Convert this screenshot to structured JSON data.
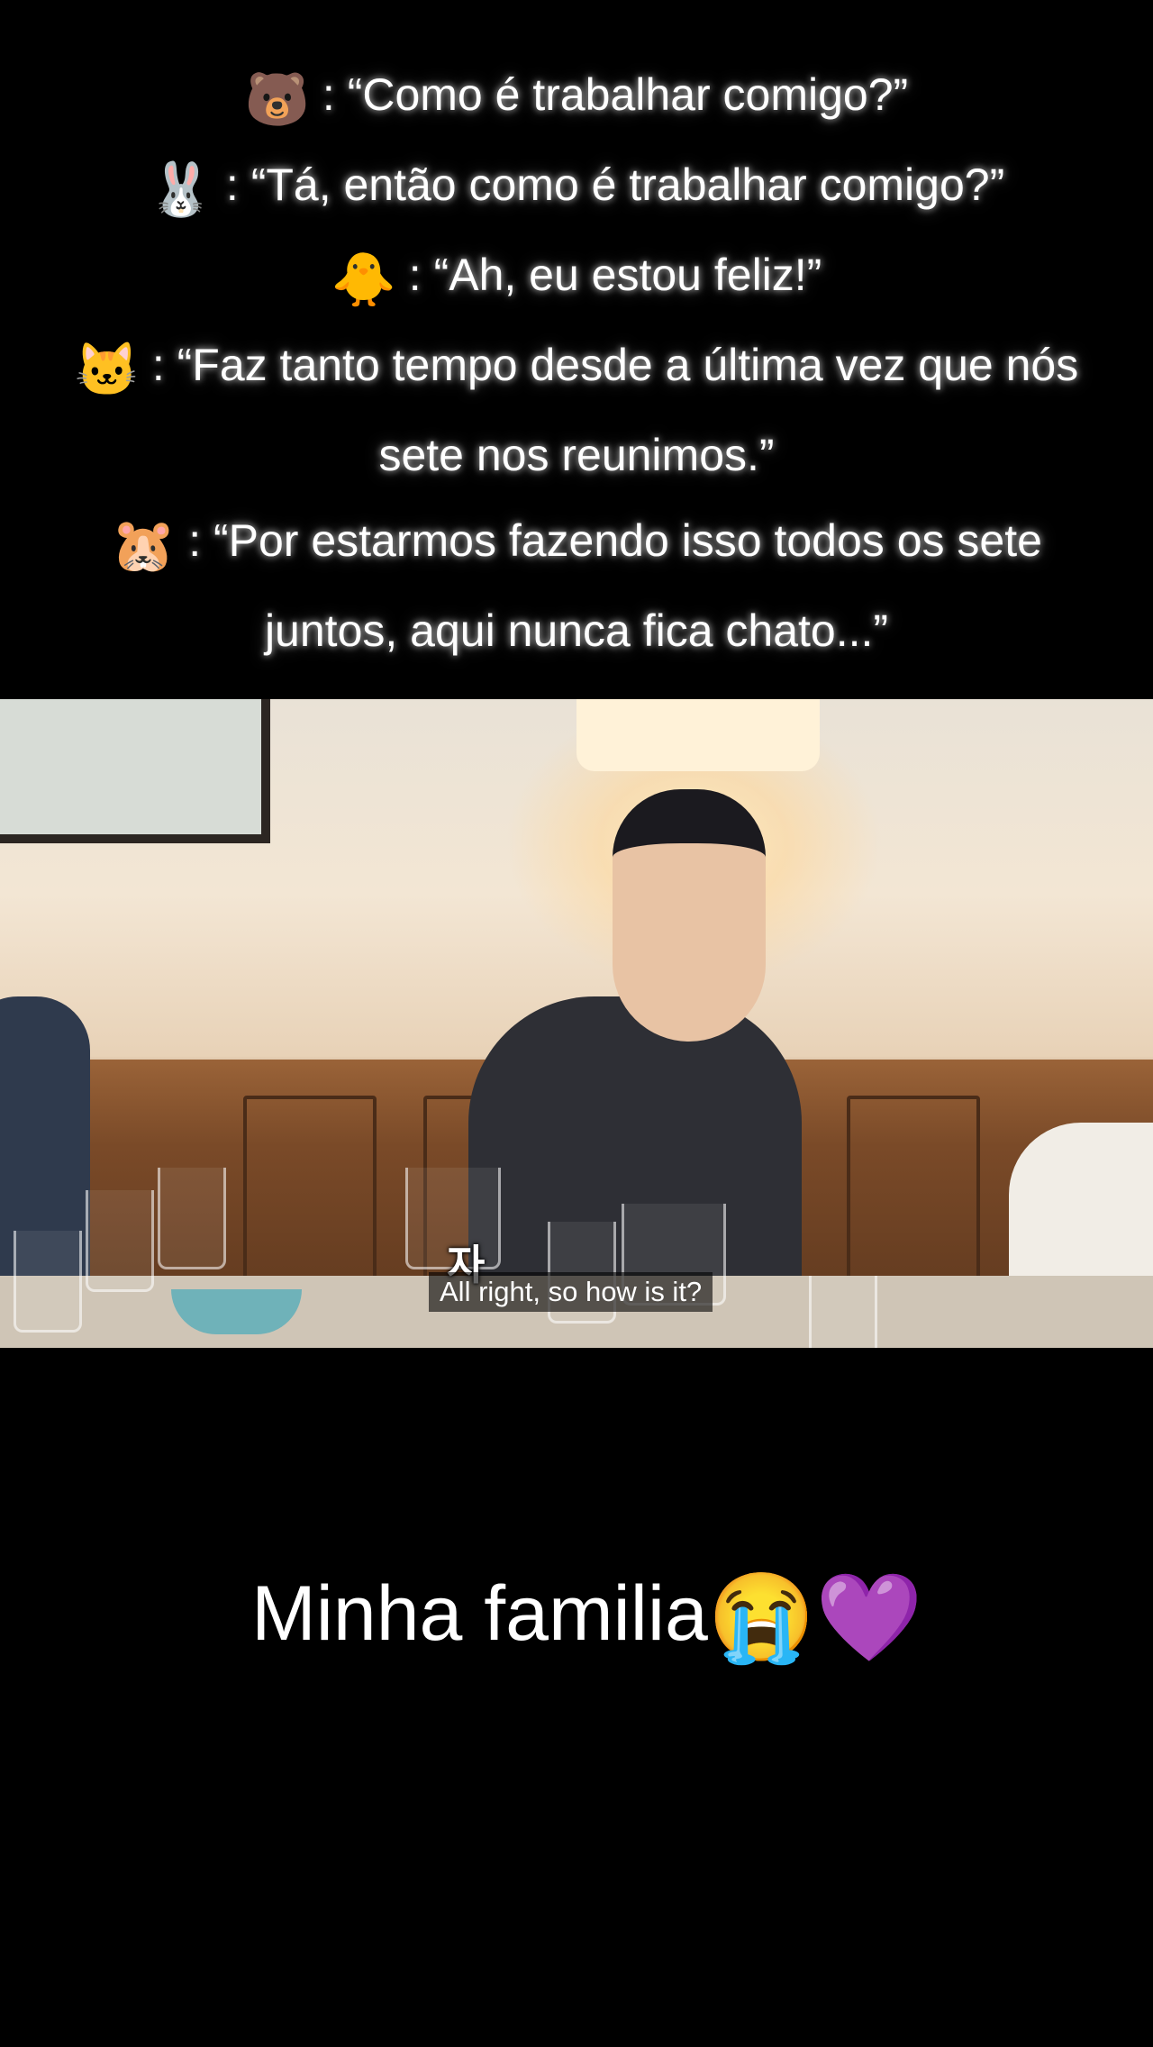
{
  "quotes": [
    {
      "icon": "🐻",
      "icon_name": "bear-icon",
      "text": ": “Como é trabalhar comigo?”"
    },
    {
      "icon": "🐰",
      "icon_name": "rabbit-icon",
      "text": ": “Tá, então como é trabalhar comigo?”"
    },
    {
      "icon": "🐥",
      "icon_name": "chick-icon",
      "text": ": “Ah, eu estou feliz!”"
    },
    {
      "icon": "🐱",
      "icon_name": "cat-icon",
      "text": ": “Faz tanto tempo desde a última vez que nós sete nos reunimos.”"
    },
    {
      "icon": "🐹",
      "icon_name": "hamster-icon",
      "text": ": “Por estarmos fazendo isso todos os sete juntos, aqui nunca fica chato...”"
    }
  ],
  "video": {
    "korean_caption": "자",
    "subtitle": "All right, so how is it?"
  },
  "caption": {
    "text": "Minha familia",
    "emoji_1": "😭",
    "emoji_1_name": "loudly-crying-face-icon",
    "emoji_2": "💜",
    "emoji_2_name": "purple-heart-icon"
  }
}
